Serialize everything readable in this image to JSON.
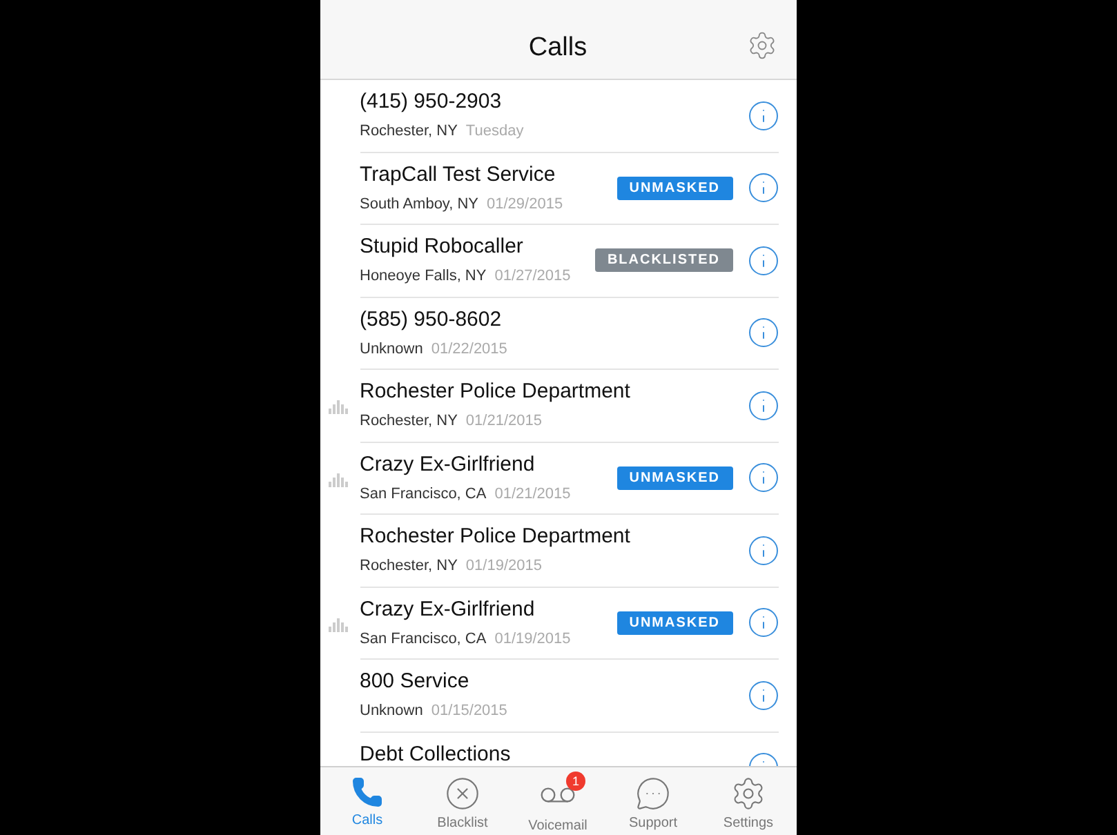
{
  "nav": {
    "title": "Calls"
  },
  "calls": [
    {
      "name": "(415) 950-2903",
      "location": "Rochester, NY",
      "date": "Tuesday",
      "recording": false
    },
    {
      "name": "TrapCall Test Service",
      "location": "South Amboy, NY",
      "date": "01/29/2015",
      "badge": {
        "kind": "unmasked",
        "text": "UNMASKED"
      },
      "recording": false
    },
    {
      "name": "Stupid Robocaller",
      "location": "Honeoye Falls, NY",
      "date": "01/27/2015",
      "badge": {
        "kind": "blacklisted",
        "text": "BLACKLISTED"
      },
      "recording": false
    },
    {
      "name": "(585) 950-8602",
      "location": "Unknown",
      "date": "01/22/2015",
      "recording": false
    },
    {
      "name": "Rochester Police Department",
      "location": "Rochester, NY",
      "date": "01/21/2015",
      "recording": true
    },
    {
      "name": "Crazy Ex-Girlfriend",
      "location": "San Francisco, CA",
      "date": "01/21/2015",
      "badge": {
        "kind": "unmasked",
        "text": "UNMASKED"
      },
      "recording": true
    },
    {
      "name": "Rochester Police Department",
      "location": "Rochester, NY",
      "date": "01/19/2015",
      "recording": false
    },
    {
      "name": "Crazy Ex-Girlfriend",
      "location": "San Francisco, CA",
      "date": "01/19/2015",
      "badge": {
        "kind": "unmasked",
        "text": "UNMASKED"
      },
      "recording": true
    },
    {
      "name": "800 Service",
      "location": "Unknown",
      "date": "01/15/2015",
      "recording": false
    },
    {
      "name": "Debt Collections"
    }
  ],
  "tabs": [
    {
      "label": "Calls",
      "kind": "phone",
      "selected": true
    },
    {
      "label": "Blacklist",
      "kind": "blacklist",
      "selected": false
    },
    {
      "label": "Voicemail",
      "kind": "voicemail",
      "selected": false,
      "badge": "1"
    },
    {
      "label": "Support",
      "kind": "support",
      "selected": false
    },
    {
      "label": "Settings",
      "kind": "settings",
      "selected": false
    }
  ]
}
